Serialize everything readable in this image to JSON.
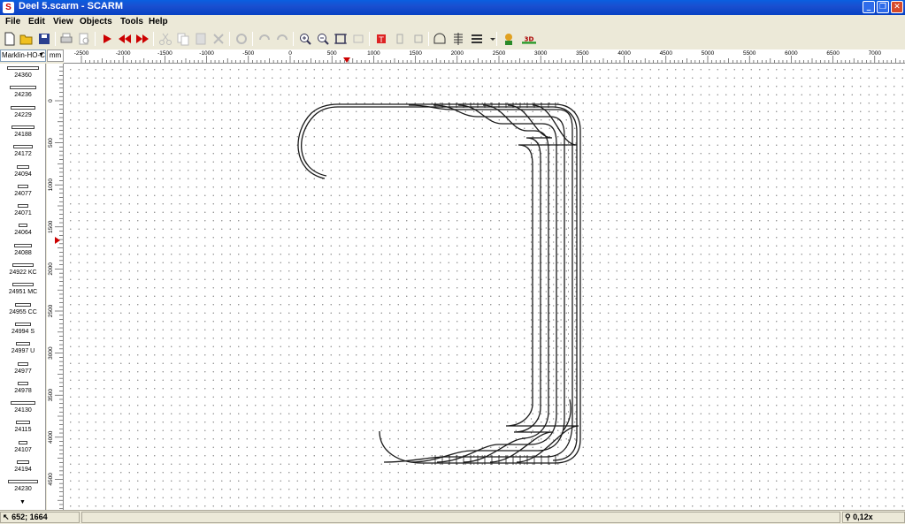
{
  "window": {
    "icon_letter": "S",
    "title": "Deel 5.scarm - SCARM",
    "minimize": "_",
    "maximize": "❐",
    "close": "✕"
  },
  "menu": [
    "File",
    "Edit",
    "View",
    "Objects",
    "Tools",
    "Help"
  ],
  "toolbar": {
    "icons": [
      "new-icon",
      "open-icon",
      "save-icon",
      "print-icon",
      "print-preview-icon",
      "run-icon",
      "rewind-icon",
      "fast-forward-icon",
      "cut-icon",
      "copy-icon",
      "paste-icon",
      "delete-icon",
      "rotate-icon",
      "undo-icon",
      "redo-icon",
      "zoom-in-icon",
      "zoom-out-icon",
      "fit-icon",
      "zoom-window-icon",
      "track-tool-icon",
      "flex-track-icon",
      "height-icon",
      "tunnel-icon",
      "ballast-icon",
      "layers-icon",
      "avatar-icon",
      "view-3d-icon"
    ],
    "view_3d_label": "3D"
  },
  "library": {
    "selected": "Marklin-HO-C",
    "unit": "mm",
    "items": [
      "24360",
      "24236",
      "24229",
      "24188",
      "24172",
      "24094",
      "24077",
      "24071",
      "24064",
      "24088",
      "24922 KC",
      "24951 MC",
      "24955 CC",
      "24994 S",
      "24997 U",
      "24977",
      "24978",
      "24130",
      "24115",
      "24107",
      "24194",
      "24230"
    ]
  },
  "ruler_top": [
    "-2500",
    "-2000",
    "-1500",
    "-1000",
    "-500",
    "0",
    "500",
    "1000",
    "1500",
    "2000",
    "2500",
    "3000",
    "3500",
    "4000",
    "4500",
    "5000",
    "5500",
    "6000",
    "6500",
    "7000"
  ],
  "ruler_left": [
    "0",
    "500",
    "1000",
    "1500",
    "2000",
    "2500",
    "3000",
    "3500",
    "4000",
    "4500"
  ],
  "status": {
    "coordinates": "652; 1664",
    "zoom": "0,12x"
  },
  "colors": {
    "titlebar": "#0a5fe0",
    "chrome": "#ece9d8",
    "track": "#1a1a1a",
    "grid_dot": "#8a8a8a"
  }
}
